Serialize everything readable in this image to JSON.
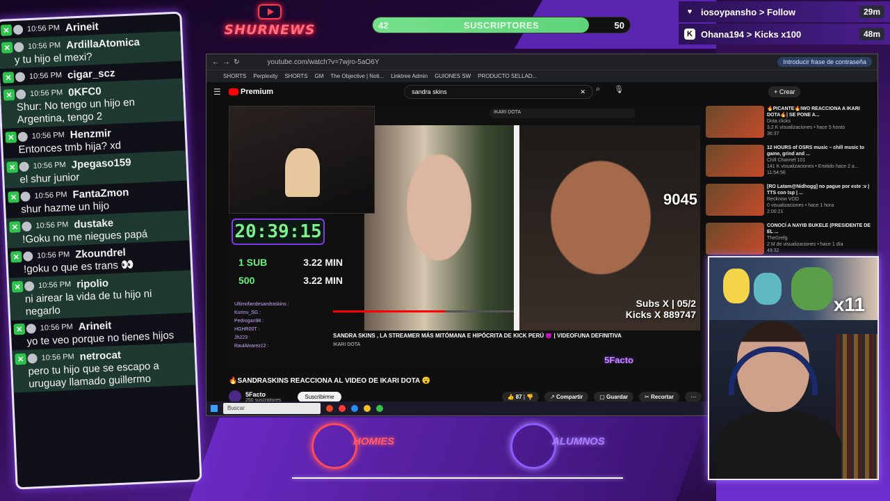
{
  "overlay": {
    "logo_text": "SHURNEWS",
    "subs_bar": {
      "current": "42",
      "label": "SUSCRIPTORES",
      "goal": "50",
      "progress": 0.84
    },
    "events": [
      {
        "icon": "heart-icon",
        "name": "iosoypansho",
        "action": "Follow",
        "time": "29m",
        "color": "#ffffff"
      },
      {
        "icon": "kick-icon",
        "name": "Ohana194",
        "action": "Kicks x100",
        "time": "48m",
        "color": "#ffffff"
      }
    ],
    "bottom_logos": [
      "HOMIES",
      "ALUMNOS"
    ]
  },
  "chat": {
    "messages": [
      {
        "time": "10:56 PM",
        "user": "Arineit",
        "text": ""
      },
      {
        "time": "10:56 PM",
        "user": "ArdillaAtomica",
        "text": "y tu hijo el mexi?"
      },
      {
        "time": "10:56 PM",
        "user": "cigar_scz",
        "text": ""
      },
      {
        "time": "10:56 PM",
        "user": "0KFC0",
        "text": "Shur: No tengo un hijo en Argentina, tengo 2"
      },
      {
        "time": "10:56 PM",
        "user": "Henzmir",
        "text": "Entonces tmb hija? xd"
      },
      {
        "time": "10:56 PM",
        "user": "Jpegaso159",
        "text": "el shur junior"
      },
      {
        "time": "10:56 PM",
        "user": "FantaZmon",
        "text": "shur hazme un hijo"
      },
      {
        "time": "10:56 PM",
        "user": "dustake",
        "text": "!Goku no me niegues papá"
      },
      {
        "time": "10:56 PM",
        "user": "Zkoundrel",
        "text": "!goku o que es trans 👀"
      },
      {
        "time": "10:56 PM",
        "user": "ripolio",
        "text": "ni airear la vida de tu hijo ni negarlo"
      },
      {
        "time": "10:56 PM",
        "user": "Arineit",
        "text": "yo te veo porque no tienes hijos"
      },
      {
        "time": "10:56 PM",
        "user": "netrocat",
        "text": "pero tu hijo que se escapo a uruguay llamado guillermo"
      }
    ]
  },
  "browser": {
    "url": "youtube.com/watch?v=7wjro-5aO6Y",
    "password_hint": "Introducir frase de contraseña",
    "bookmarks": [
      "SHORTS",
      "Perplexity",
      "SHORTS",
      "GM",
      "The Objective | Noti...",
      "Linktree Admin",
      "GUIONES SW",
      "PRODUCTO SELLAD..."
    ],
    "youtube": {
      "logo": "Premium",
      "search_query": "sandra skins",
      "create_label": "Crear",
      "inner_search": "IKARI DOTA",
      "timer": "20:39:15",
      "goals": [
        {
          "label": "1 SUB",
          "time": "3.22 MIN"
        },
        {
          "label": "500",
          "time": "3.22 MIN"
        }
      ],
      "counter": "9045",
      "subs_line": "Subs X | 05/2",
      "kicks_line": "Kicks X 889747",
      "mini_chat": [
        "Ultimofandesandraskins : ",
        "Kurinu_SG : ",
        "Pedrogan98 : ",
        "HGHR00T : ",
        "Jh223 : ",
        "RaulAlvarez12 : "
      ],
      "inner_title": "SANDRA SKINS , LA STREAMER MÁS MITÓMANA E HIPÓCRITA DE KICK PERÚ 😈 | VIDEOFUNA DEFINITIVA",
      "inner_channel": "IKARI DOTA",
      "inner_progress": 0.62,
      "video_title": "🔥SANDRASKINS REACCIONA AL VIDEO DE IKARI DOTA 😮",
      "channel": "5Facto",
      "channel_subs": "250 suscriptores",
      "subscribe_label": "Suscribirme",
      "likes": "87",
      "share_label": "Compartir",
      "save_label": "Guardar",
      "clip_label": "Recortar",
      "watermark": "5Facto",
      "recommendations": [
        {
          "title": "🔥PICANTE🔥IWO REACCIONA A IKARI DOTA🔥| SE PONE A...",
          "channel": "Dota clicks",
          "meta": "3,2 K visualizaciones • hace 5 horas",
          "duration": "36:37"
        },
        {
          "title": "12 HOURS of OSRS music – chill music to game, grind and ...",
          "channel": "Chill Channel 101",
          "meta": "141 K visualizaciones • Emitido hace 2 a...",
          "duration": "11:54:56"
        },
        {
          "title": "[RO Latam@Nidhogg] no pague por este :v | TTS con tsp | ...",
          "channel": "Recknow VOD",
          "meta": "0 visualizaciones • hace 1 hora",
          "duration": "2:00:21"
        },
        {
          "title": "CONOCÍ A NAYIB BUKELE (PRESIDENTE DE EL ...",
          "channel": "TheGrefg",
          "meta": "2 M de visualizaciones • hace 1 día",
          "duration": "49:32"
        }
      ]
    },
    "taskbar": {
      "search_placeholder": "Buscar"
    }
  },
  "webcam": {
    "multiplier": "x11"
  }
}
